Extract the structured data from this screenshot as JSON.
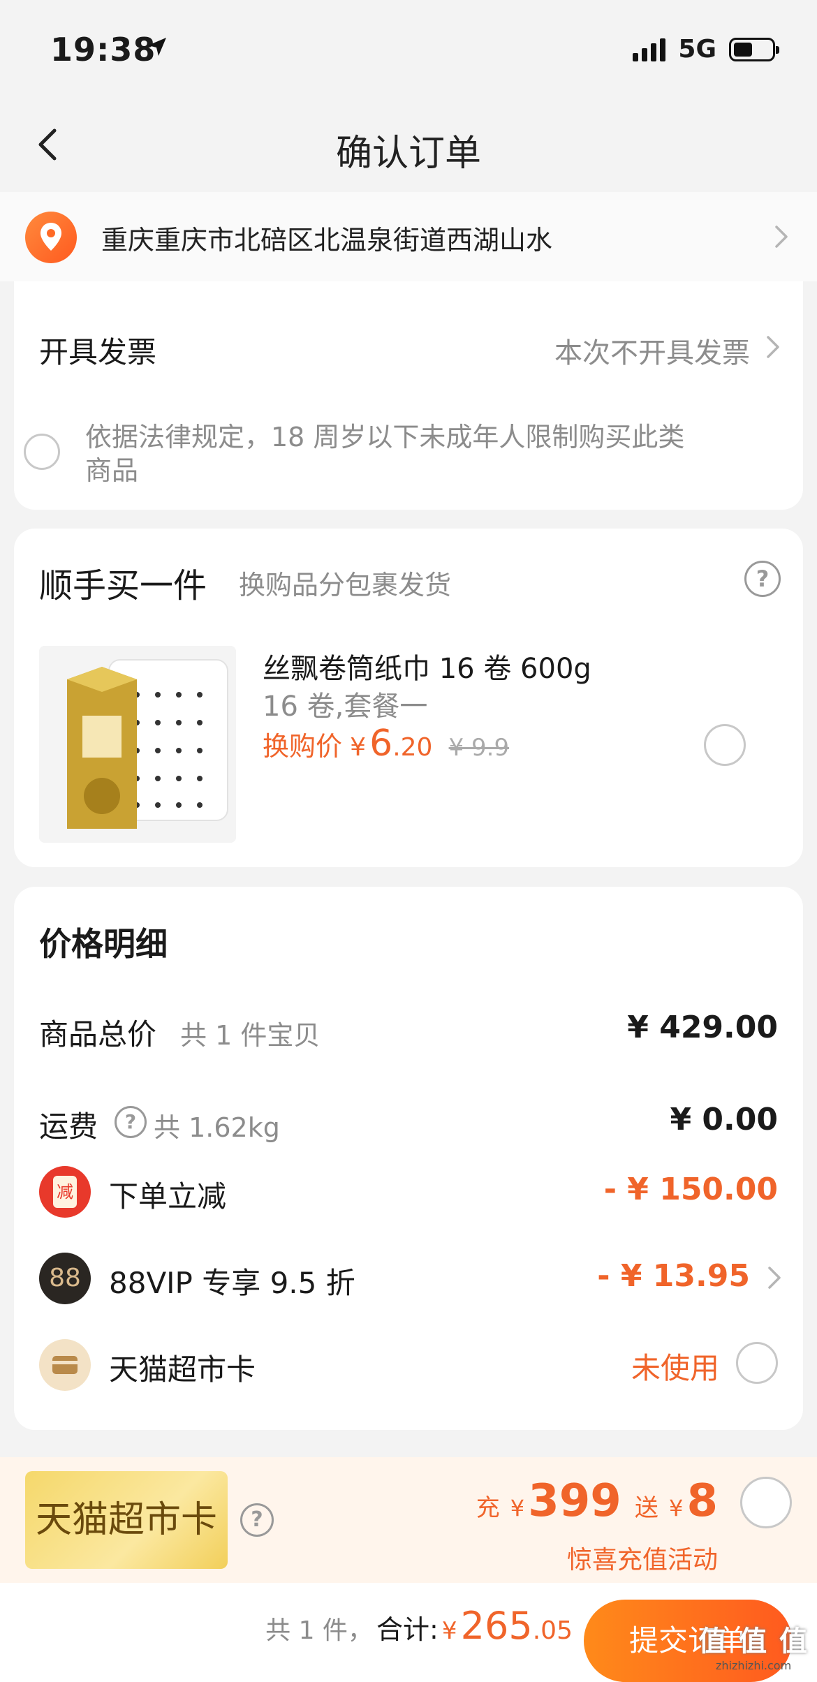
{
  "status_bar": {
    "time": "19:38",
    "network": "5G",
    "battery_level": 0.5
  },
  "nav": {
    "title": "确认订单"
  },
  "address": {
    "text": "重庆重庆市北碚区北温泉街道西湖山水"
  },
  "invoice": {
    "label": "开具发票",
    "value": "本次不开具发票",
    "age_notice_line1": "依据法律规定，18 周岁以下未成年人限制购买此类",
    "age_notice_line2": "商品"
  },
  "addon": {
    "title": "顺手买一件",
    "subtitle": "换购品分包裹发货",
    "product": {
      "name": "丝飘卷筒纸巾 16 卷 600g",
      "spec": "16 卷,套餐一",
      "price_label": "换购价",
      "currency": "¥",
      "price_int": "6",
      "price_dec": ".20",
      "original_price": "¥ 9.9"
    }
  },
  "price_detail": {
    "title": "价格明细",
    "goods_total_label": "商品总价",
    "goods_count": "共 1 件宝贝",
    "goods_total": "¥ 429.00",
    "shipping_label": "运费",
    "shipping_weight": "共 1.62kg",
    "shipping_value": "¥ 0.00",
    "instant_discount_icon": "减",
    "instant_discount_label": "下单立减",
    "instant_discount_value": "- ¥ 150.00",
    "vip_icon": "88",
    "vip_label": "88VIP 专享 9.5 折",
    "vip_value": "- ¥ 13.95",
    "tmall_card_label": "天猫超市卡",
    "tmall_card_value": "未使用"
  },
  "banner": {
    "card_label": "天猫超市卡",
    "charge_prefix": "充",
    "charge_currency": "¥",
    "charge_amount": "399",
    "gift_prefix": "送",
    "gift_currency": "¥",
    "gift_amount": "8",
    "activity": "惊喜充值活动"
  },
  "footer": {
    "count": "共 1 件，",
    "total_label": "合计:",
    "currency": "¥",
    "total_int": "265",
    "total_dec": ".05",
    "submit_label": "提交订单",
    "watermark": "值 值 值",
    "watermark_url": "zhizhizhi.com"
  },
  "colors": {
    "accent": "#f0642a",
    "gray_text": "#8c8c8c",
    "page_bg": "#f3f3f3"
  },
  "icons": [
    "location-arrow-icon",
    "signal-icon",
    "battery-icon",
    "back-arrow-icon",
    "location-pin-icon",
    "chevron-right-icon",
    "help-icon",
    "discount-icon",
    "vip-88-icon",
    "card-icon"
  ]
}
